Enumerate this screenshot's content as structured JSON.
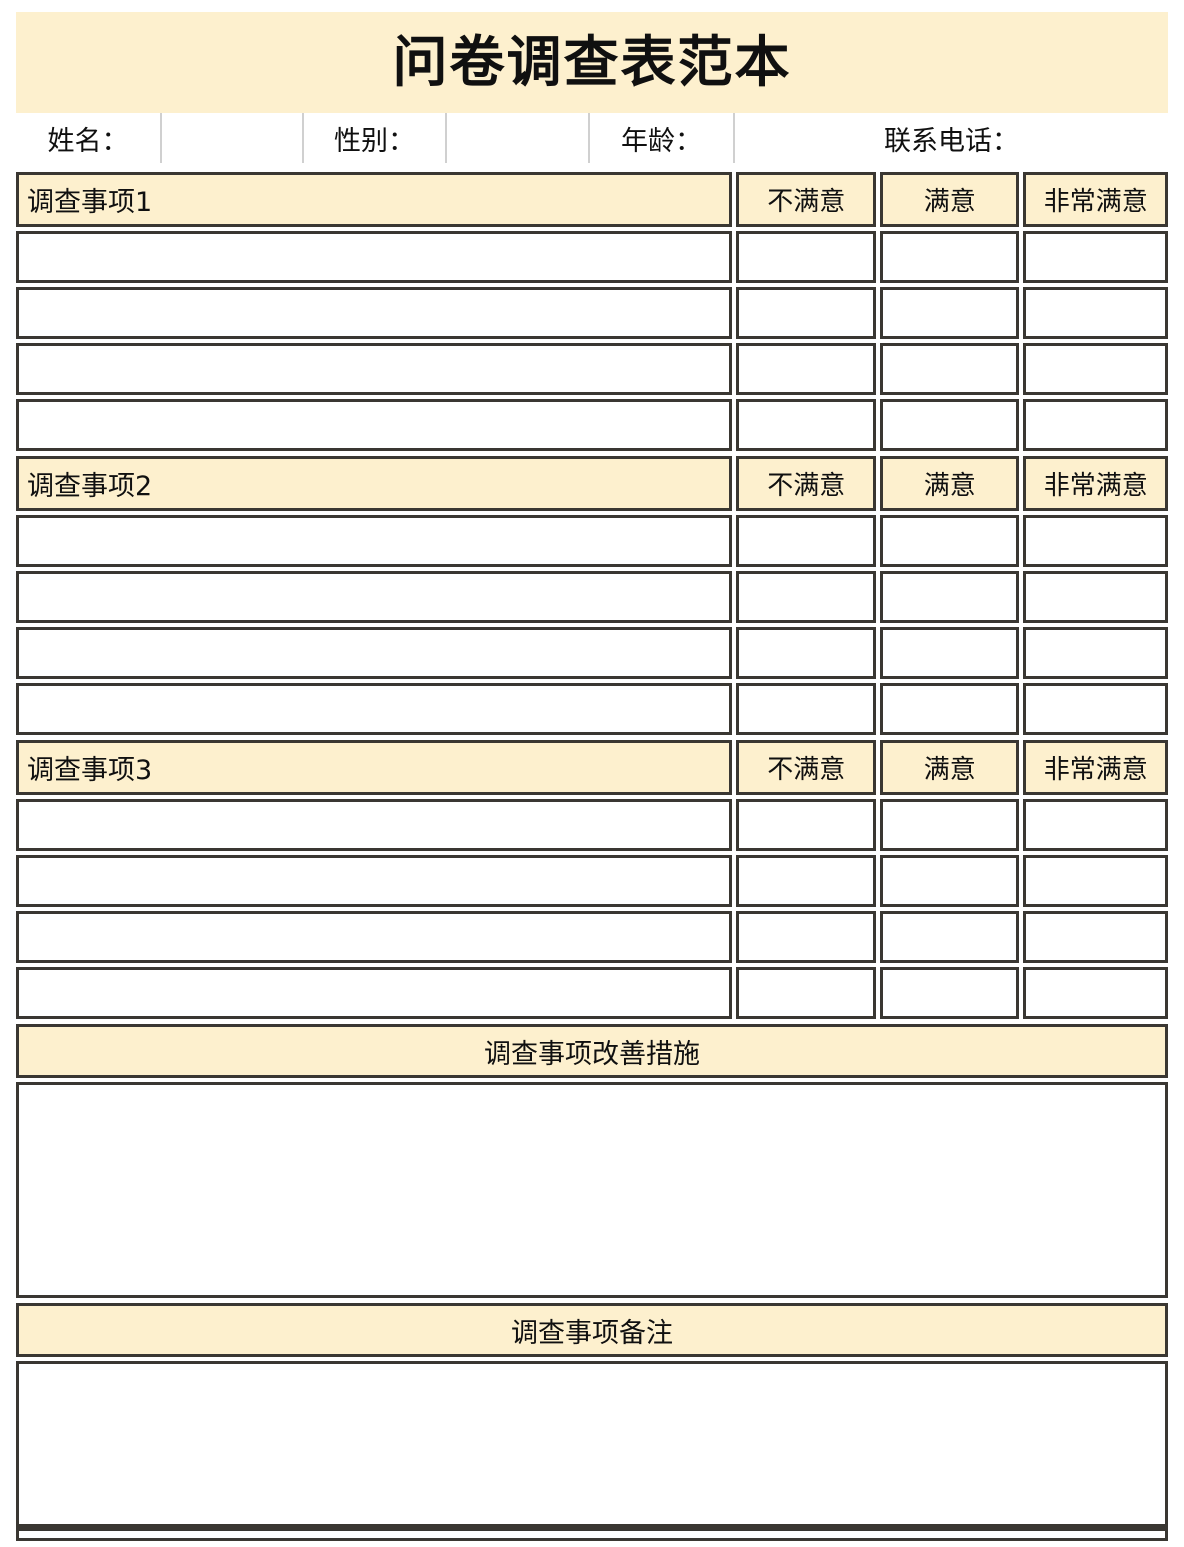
{
  "document": {
    "title": "问卷调查表范本",
    "accent_bg": "#FDF0CE",
    "border_color": "#3a3732",
    "text_color": "#101010"
  },
  "info_row": {
    "name_label": "姓名：",
    "name_value": "",
    "gender_label": "性别：",
    "gender_value": "",
    "age_label": "年龄：",
    "age_value": "",
    "phone_label": "联系电话：",
    "phone_value": ""
  },
  "rating_columns": {
    "dissatisfied": "不满意",
    "satisfied": "满意",
    "very_satisfied": "非常满意"
  },
  "sections": [
    {
      "header": "调查事项1",
      "rows": [
        {
          "item": "",
          "dissatisfied": "",
          "satisfied": "",
          "very_satisfied": ""
        },
        {
          "item": "",
          "dissatisfied": "",
          "satisfied": "",
          "very_satisfied": ""
        },
        {
          "item": "",
          "dissatisfied": "",
          "satisfied": "",
          "very_satisfied": ""
        },
        {
          "item": "",
          "dissatisfied": "",
          "satisfied": "",
          "very_satisfied": ""
        }
      ]
    },
    {
      "header": "调查事项2",
      "rows": [
        {
          "item": "",
          "dissatisfied": "",
          "satisfied": "",
          "very_satisfied": ""
        },
        {
          "item": "",
          "dissatisfied": "",
          "satisfied": "",
          "very_satisfied": ""
        },
        {
          "item": "",
          "dissatisfied": "",
          "satisfied": "",
          "very_satisfied": ""
        },
        {
          "item": "",
          "dissatisfied": "",
          "satisfied": "",
          "very_satisfied": ""
        }
      ]
    },
    {
      "header": "调查事项3",
      "rows": [
        {
          "item": "",
          "dissatisfied": "",
          "satisfied": "",
          "very_satisfied": ""
        },
        {
          "item": "",
          "dissatisfied": "",
          "satisfied": "",
          "very_satisfied": ""
        },
        {
          "item": "",
          "dissatisfied": "",
          "satisfied": "",
          "very_satisfied": ""
        },
        {
          "item": "",
          "dissatisfied": "",
          "satisfied": "",
          "very_satisfied": ""
        }
      ]
    }
  ],
  "improvement": {
    "header": "调查事项改善措施",
    "body": ""
  },
  "remarks": {
    "header": "调查事项备注",
    "body": ""
  }
}
